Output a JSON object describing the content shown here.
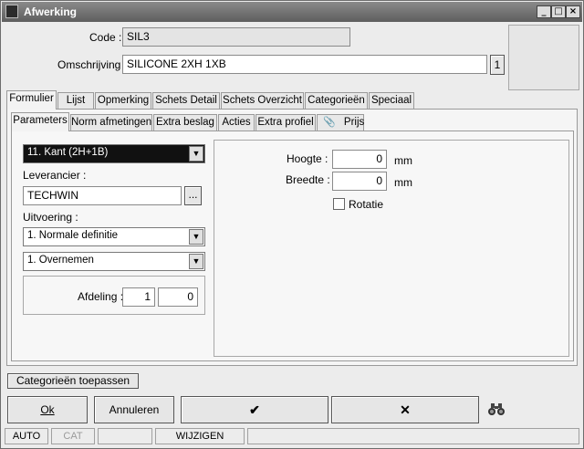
{
  "window": {
    "title": "Afwerking",
    "minimize": "_",
    "maximize": "□",
    "close": "×"
  },
  "header": {
    "code_label": "Code :",
    "code_value": "SIL3",
    "omschrijving_label": "Omschrijving :",
    "omschrijving_value": "SILICONE  2XH 1XB",
    "lang_badge": "1"
  },
  "main_tabs": [
    "Formulier",
    "Lijst",
    "Opmerking",
    "Schets Detail",
    "Schets Overzicht",
    "Categorieën",
    "Speciaal"
  ],
  "sub_tabs": [
    "Parameters",
    "Norm afmetingen",
    "Extra beslag",
    "Acties",
    "Extra profiel",
    "Prijs"
  ],
  "left": {
    "type_select": "11. Kant (2H+1B)",
    "leverancier_label": "Leverancier :",
    "leverancier_value": "TECHWIN",
    "browse_button": "...",
    "uitvoering_label": "Uitvoering :",
    "uitvoering_select": "1.  Normale definitie",
    "overnemen_select": "1.  Overnemen",
    "afdeling_label": "Afdeling :",
    "afdeling_value1": "1",
    "afdeling_value2": "0"
  },
  "right": {
    "hoogte_label": "Hoogte :",
    "hoogte_value": "0",
    "hoogte_unit": "mm",
    "breedte_label": "Breedte :",
    "breedte_value": "0",
    "breedte_unit": "mm",
    "rotatie_label": "Rotatie"
  },
  "buttons": {
    "categorieen": "Categorieën toepassen",
    "ok": "Ok",
    "annuleren": "Annuleren",
    "check": "✔",
    "cross": "✕",
    "binoculars": "binoculars-icon"
  },
  "statusbar": [
    "AUTO",
    "CAT",
    "",
    "WIJZIGEN"
  ]
}
